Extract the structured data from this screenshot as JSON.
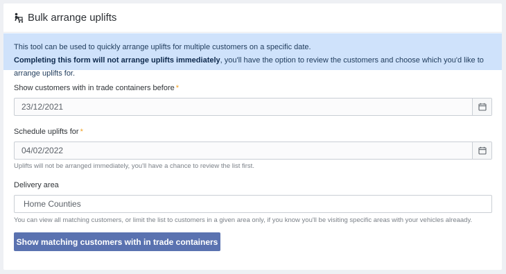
{
  "page": {
    "title": "Bulk arrange uplifts"
  },
  "info": {
    "line1": "This tool can be used to quickly arrange uplifts for multiple customers on a specific date.",
    "line2_bold": "Completing this form will not arrange uplifts immediately",
    "line2_rest": ", you'll have the option to review the customers and choose which you'd like to arrange uplifts for."
  },
  "form": {
    "before_date": {
      "label": "Show customers with in trade containers before",
      "required_mark": "*",
      "value": "23/12/2021"
    },
    "uplift_date": {
      "label": "Schedule uplifts for",
      "required_mark": "*",
      "value": "04/02/2022",
      "help": "Uplifts will not be arranged immediately, you'll have a chance to review the list first."
    },
    "delivery_area": {
      "label": "Delivery area",
      "value": "Home Counties",
      "help": "You can view all matching customers, or limit the list to customers in a given area only, if you know you'll be visiting specific areas with your vehicles alreaady."
    },
    "submit_label": "Show matching customers with in trade containers"
  },
  "colors": {
    "info_bg": "#cfe2fb",
    "required": "#f0a020",
    "button_bg": "#5a72b0"
  },
  "icons": {
    "header": "person-with-trolley-icon",
    "date_picker": "calendar-icon"
  }
}
